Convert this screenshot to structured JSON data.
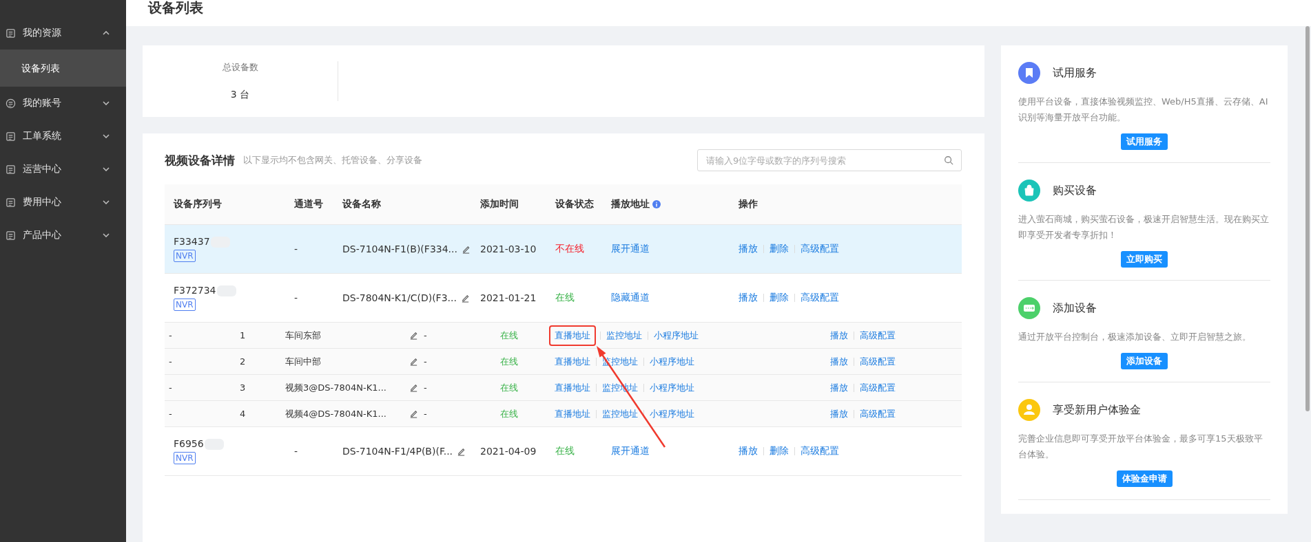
{
  "page_title": "设备列表",
  "sidebar": {
    "items": [
      {
        "label": "我的资源",
        "expanded": true,
        "children": [
          {
            "label": "设备列表",
            "selected": true
          }
        ]
      },
      {
        "label": "我的账号",
        "expanded": false
      },
      {
        "label": "工单系统",
        "expanded": false
      },
      {
        "label": "运营中心",
        "expanded": false
      },
      {
        "label": "费用中心",
        "expanded": false
      },
      {
        "label": "产品中心",
        "expanded": false
      }
    ]
  },
  "stats": {
    "label": "总设备数",
    "value": "3 台"
  },
  "details": {
    "title": "视频设备详情",
    "note": "以下显示均不包含网关、托管设备、分享设备",
    "search": {
      "placeholder": "请输入9位字母或数字的序列号搜索"
    },
    "columns": [
      "设备序列号",
      "通道号",
      "设备名称",
      "添加时间",
      "设备状态",
      "播放地址",
      "操作"
    ],
    "rows": [
      {
        "kind": "device",
        "selected": true,
        "serial": "F33437",
        "tag": "NVR",
        "channel": "-",
        "name": "DS-7104N-F1(B)(F334...",
        "date": "2021-03-10",
        "status": "不在线",
        "online": false,
        "links": [
          {
            "label": "展开通道",
            "highlighted": false
          }
        ],
        "actions": [
          "播放",
          "删除",
          "高级配置"
        ]
      },
      {
        "kind": "device",
        "selected": false,
        "serial": "F372734",
        "tag": "NVR",
        "channel": "-",
        "name": "DS-7804N-K1/C(D)(F3...",
        "date": "2021-01-21",
        "status": "在线",
        "online": true,
        "links": [
          {
            "label": "隐藏通道",
            "highlighted": false
          }
        ],
        "actions": [
          "播放",
          "删除",
          "高级配置"
        ]
      },
      {
        "kind": "channel",
        "selected": false,
        "serial": "-",
        "channel": "1",
        "name": "车间东部",
        "date": "-",
        "status": "在线",
        "online": true,
        "links": [
          {
            "label": "直播地址",
            "highlighted": true
          },
          {
            "label": "监控地址",
            "highlighted": false
          },
          {
            "label": "小程序地址",
            "highlighted": false
          }
        ],
        "actions": [
          "播放",
          "高级配置"
        ]
      },
      {
        "kind": "channel",
        "selected": false,
        "serial": "-",
        "channel": "2",
        "name": "车间中部",
        "date": "-",
        "status": "在线",
        "online": true,
        "links": [
          {
            "label": "直播地址",
            "highlighted": false
          },
          {
            "label": "监控地址",
            "highlighted": false
          },
          {
            "label": "小程序地址",
            "highlighted": false
          }
        ],
        "actions": [
          "播放",
          "高级配置"
        ]
      },
      {
        "kind": "channel",
        "selected": false,
        "serial": "-",
        "channel": "3",
        "name": "视频3@DS-7804N-K1...",
        "date": "-",
        "status": "在线",
        "online": true,
        "links": [
          {
            "label": "直播地址",
            "highlighted": false
          },
          {
            "label": "监控地址",
            "highlighted": false
          },
          {
            "label": "小程序地址",
            "highlighted": false
          }
        ],
        "actions": [
          "播放",
          "高级配置"
        ]
      },
      {
        "kind": "channel",
        "selected": false,
        "serial": "-",
        "channel": "4",
        "name": "视频4@DS-7804N-K1...",
        "date": "-",
        "status": "在线",
        "online": true,
        "links": [
          {
            "label": "直播地址",
            "highlighted": false
          },
          {
            "label": "监控地址",
            "highlighted": false
          },
          {
            "label": "小程序地址",
            "highlighted": false
          }
        ],
        "actions": [
          "播放",
          "高级配置"
        ]
      },
      {
        "kind": "device",
        "selected": false,
        "serial": "F6956",
        "tag": "NVR",
        "channel": "-",
        "name": "DS-7104N-F1/4P(B)(F...",
        "date": "2021-04-09",
        "status": "在线",
        "online": true,
        "links": [
          {
            "label": "展开通道",
            "highlighted": false
          }
        ],
        "actions": [
          "播放",
          "删除",
          "高级配置"
        ]
      }
    ]
  },
  "promos": [
    {
      "title": "试用服务",
      "text": "使用平台设备，直接体验视频监控、Web/H5直播、云存储、AI识别等海量开放平台功能。",
      "button": "试用服务",
      "color": "#5b7cf5"
    },
    {
      "title": "购买设备",
      "text": "进入萤石商城，购买萤石设备，极速开启智慧生活。现在购买立即享受开发者专享折扣！",
      "button": "立即购买",
      "color": "#1bc4b8"
    },
    {
      "title": "添加设备",
      "text": "通过开放平台控制台，极速添加设备、立即开启智慧之旅。",
      "button": "添加设备",
      "color": "#4cd06a"
    },
    {
      "title": "享受新用户体验金",
      "text": "完善企业信息即可享受开放平台体验金，最多可享15天极致平台体验。",
      "button": "体验金申请",
      "color": "#fbc70f"
    }
  ]
}
